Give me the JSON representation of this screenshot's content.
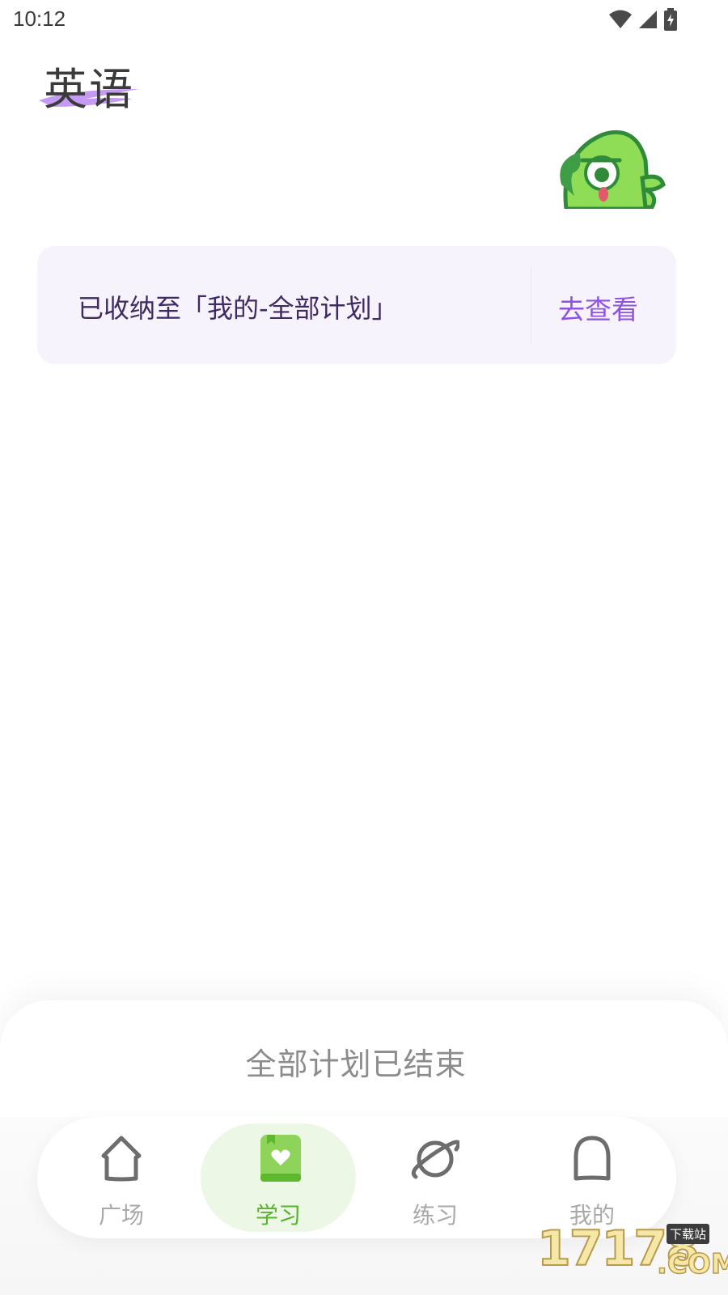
{
  "status_bar": {
    "time": "10:12"
  },
  "header": {
    "title": "英语"
  },
  "notice": {
    "message": "已收纳至「我的-全部计划」",
    "action": "去查看"
  },
  "sheet": {
    "status_text": "全部计划已结束"
  },
  "bottom_nav": {
    "items": [
      {
        "label": "广场",
        "icon": "home-icon",
        "active": false
      },
      {
        "label": "学习",
        "icon": "book-heart-icon",
        "active": true
      },
      {
        "label": "练习",
        "icon": "planet-icon",
        "active": false
      },
      {
        "label": "我的",
        "icon": "profile-bell-icon",
        "active": false
      }
    ]
  },
  "colors": {
    "accent_purple": "#8e54e0",
    "active_green": "#58b22e",
    "notice_bg": "#f6f3fd"
  },
  "watermark": {
    "digits": "17178",
    "badge": "下载站",
    "suffix": ".COM"
  }
}
